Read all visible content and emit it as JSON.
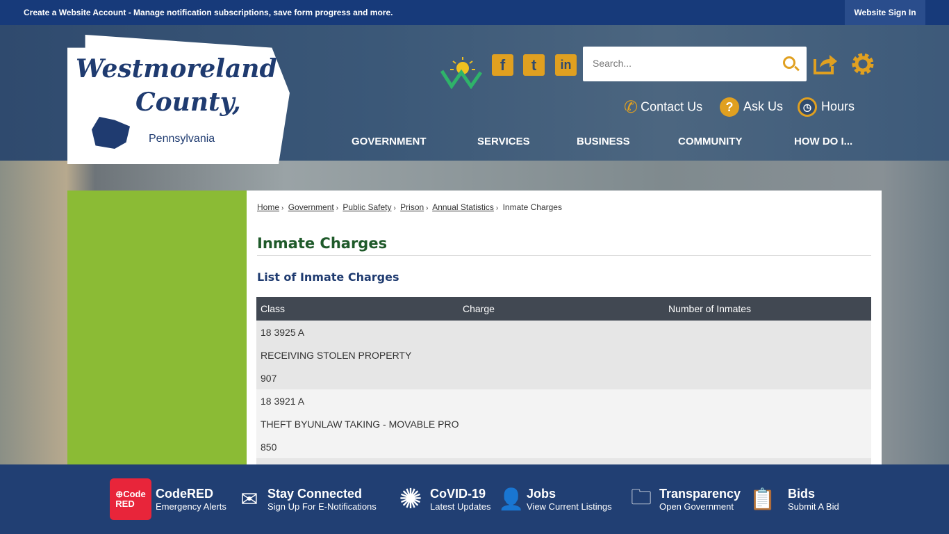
{
  "topbar": {
    "message": "Create a Website Account - Manage notification subscriptions, save form progress and more.",
    "signin": "Website Sign In"
  },
  "logo": {
    "line1": "Westmoreland",
    "line2": "County,",
    "line3": "Pennsylvania"
  },
  "social": {
    "facebook": "f",
    "twitter": "t",
    "linkedin": "in"
  },
  "search": {
    "placeholder": "Search..."
  },
  "quicklinks": [
    {
      "label": "Contact Us"
    },
    {
      "label": "Ask Us"
    },
    {
      "label": "Hours"
    }
  ],
  "nav": [
    "GOVERNMENT",
    "SERVICES",
    "BUSINESS",
    "COMMUNITY",
    "HOW DO I..."
  ],
  "breadcrumb": {
    "items": [
      "Home",
      "Government",
      "Public Safety",
      "Prison",
      "Annual Statistics"
    ],
    "current": "Inmate Charges"
  },
  "page": {
    "title": "Inmate Charges",
    "subtitle": "List of Inmate Charges"
  },
  "table": {
    "headers": [
      "Class",
      "Charge",
      "Number of Inmates"
    ],
    "rows": [
      {
        "class": "18 3925 A",
        "charge": "RECEIVING STOLEN PROPERTY",
        "count": "907"
      },
      {
        "class": "18 3921 A",
        "charge": "THEFT BYUNLAW TAKING - MOVABLE PRO",
        "count": "850"
      }
    ]
  },
  "footer": [
    {
      "title": "CodeRED",
      "sub": "Emergency Alerts",
      "icon": "codered-icon"
    },
    {
      "title": "Stay Connected",
      "sub": "Sign Up For E-Notifications",
      "icon": "envelope-icon"
    },
    {
      "title": "CoVID-19",
      "sub": "Latest Updates",
      "icon": "virus-icon"
    },
    {
      "title": "Jobs",
      "sub": "View Current Listings",
      "icon": "person-icon"
    },
    {
      "title": "Transparency",
      "sub": "Open Government",
      "icon": "folder-search-icon"
    },
    {
      "title": "Bids",
      "sub": "Submit A Bid",
      "icon": "clipboard-icon"
    }
  ],
  "colors": {
    "accent": "#e0a020",
    "navy": "#213f73",
    "green": "#8bbb35"
  }
}
